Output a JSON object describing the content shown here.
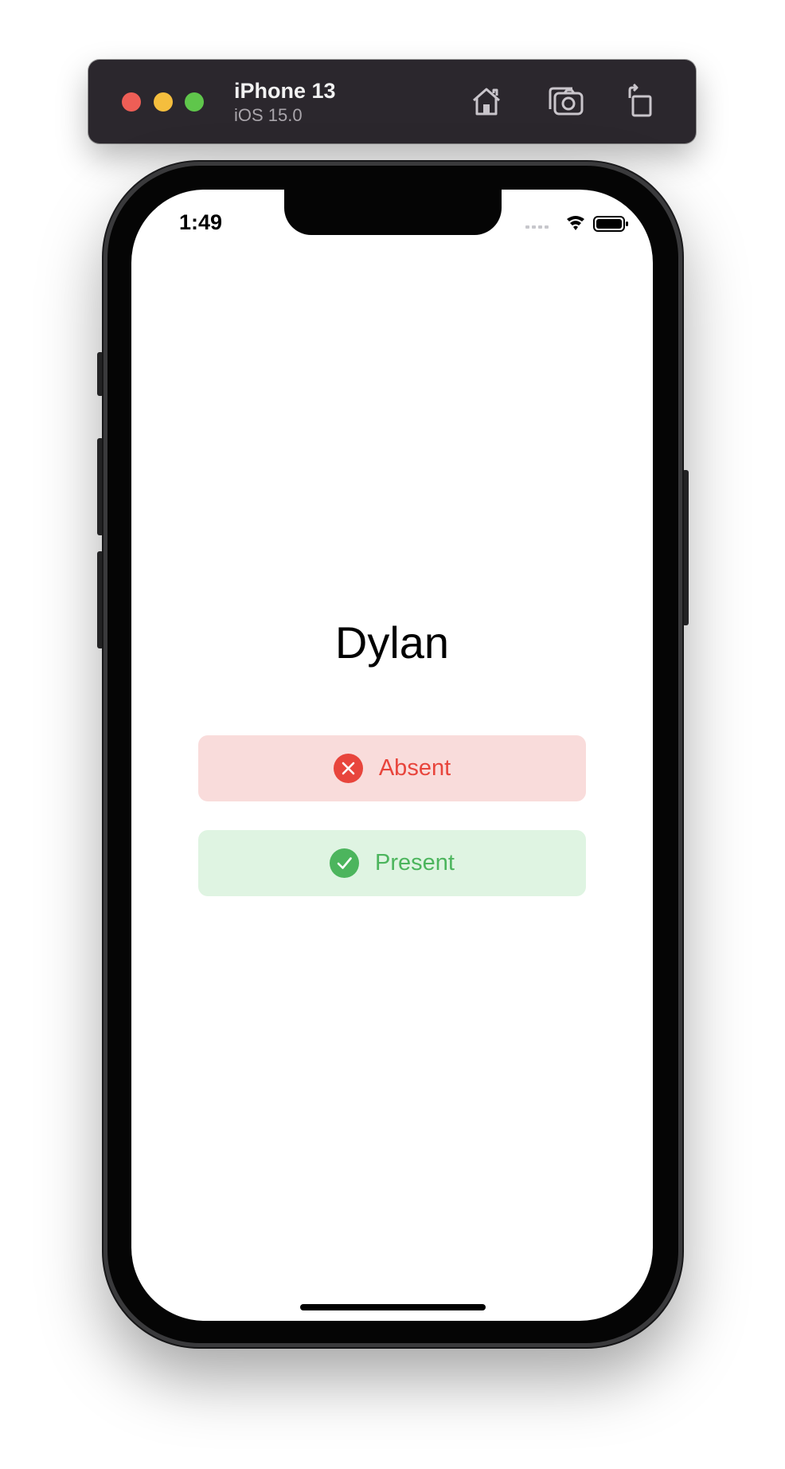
{
  "simulator": {
    "device_name": "iPhone 13",
    "os_version": "iOS 15.0",
    "toolbar_icons": [
      "home-icon",
      "screenshot-icon",
      "rotate-icon"
    ],
    "traffic_lights": {
      "close": "#ee5e56",
      "minimize": "#f5be3d",
      "zoom": "#5fc64b"
    }
  },
  "status_bar": {
    "time": "1:49",
    "icons": [
      "cellular-signal-icon",
      "wifi-icon",
      "battery-icon"
    ]
  },
  "screen": {
    "student_name": "Dylan",
    "buttons": [
      {
        "label": "Absent",
        "icon": "x-circle-icon",
        "text_color": "#e8453c",
        "background": "#f9dcdb"
      },
      {
        "label": "Present",
        "icon": "checkmark-circle-icon",
        "text_color": "#4cb55d",
        "background": "#dff4e2"
      }
    ]
  }
}
